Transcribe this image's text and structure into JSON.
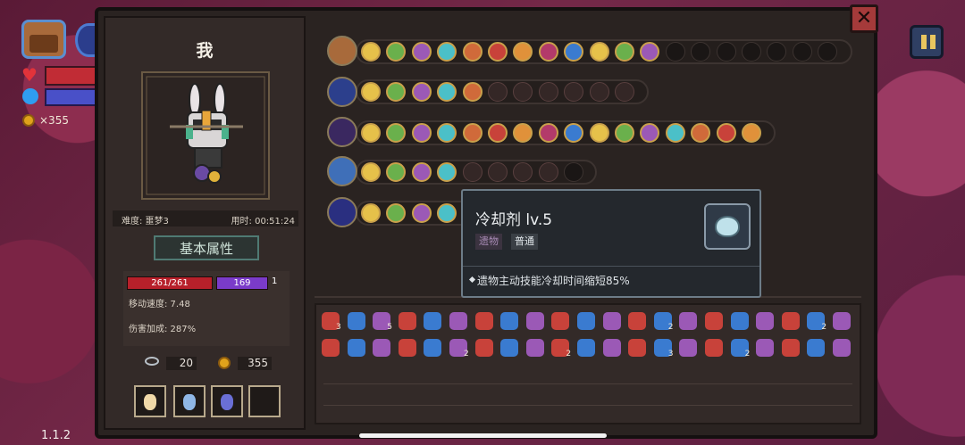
{
  "hud": {
    "coins": "×355",
    "version": "1.1.2"
  },
  "character": {
    "name": "我",
    "difficulty": "难度: 噩梦3",
    "time": "用时: 00:51:24",
    "attributes_title": "基本属性",
    "hp": "261/261",
    "mp": "169",
    "mp_extra": "1",
    "move_speed": "移动速度: 7.48",
    "damage_bonus": "伤害加成: 287%",
    "keys": "20",
    "gold": "355"
  },
  "tooltip": {
    "title": "冷却剂 lv.5",
    "tag_type": "遗物",
    "tag_rarity": "普通",
    "description": "遗物主动技能冷却时间缩短85%"
  },
  "colors": {
    "panel": "#2a2321",
    "accent_gold": "#c9a04b",
    "hp": "#b7202a",
    "mp": "#7a3bc9"
  },
  "icons": [
    "chest-icon",
    "close-icon",
    "pause-icon",
    "heart-icon",
    "mana-orb-icon",
    "coin-icon",
    "key-icon",
    "coolant-drop-icon"
  ],
  "inventory_counts": [
    "3",
    "5",
    "2",
    "2",
    "2",
    "2",
    "3",
    "2"
  ]
}
